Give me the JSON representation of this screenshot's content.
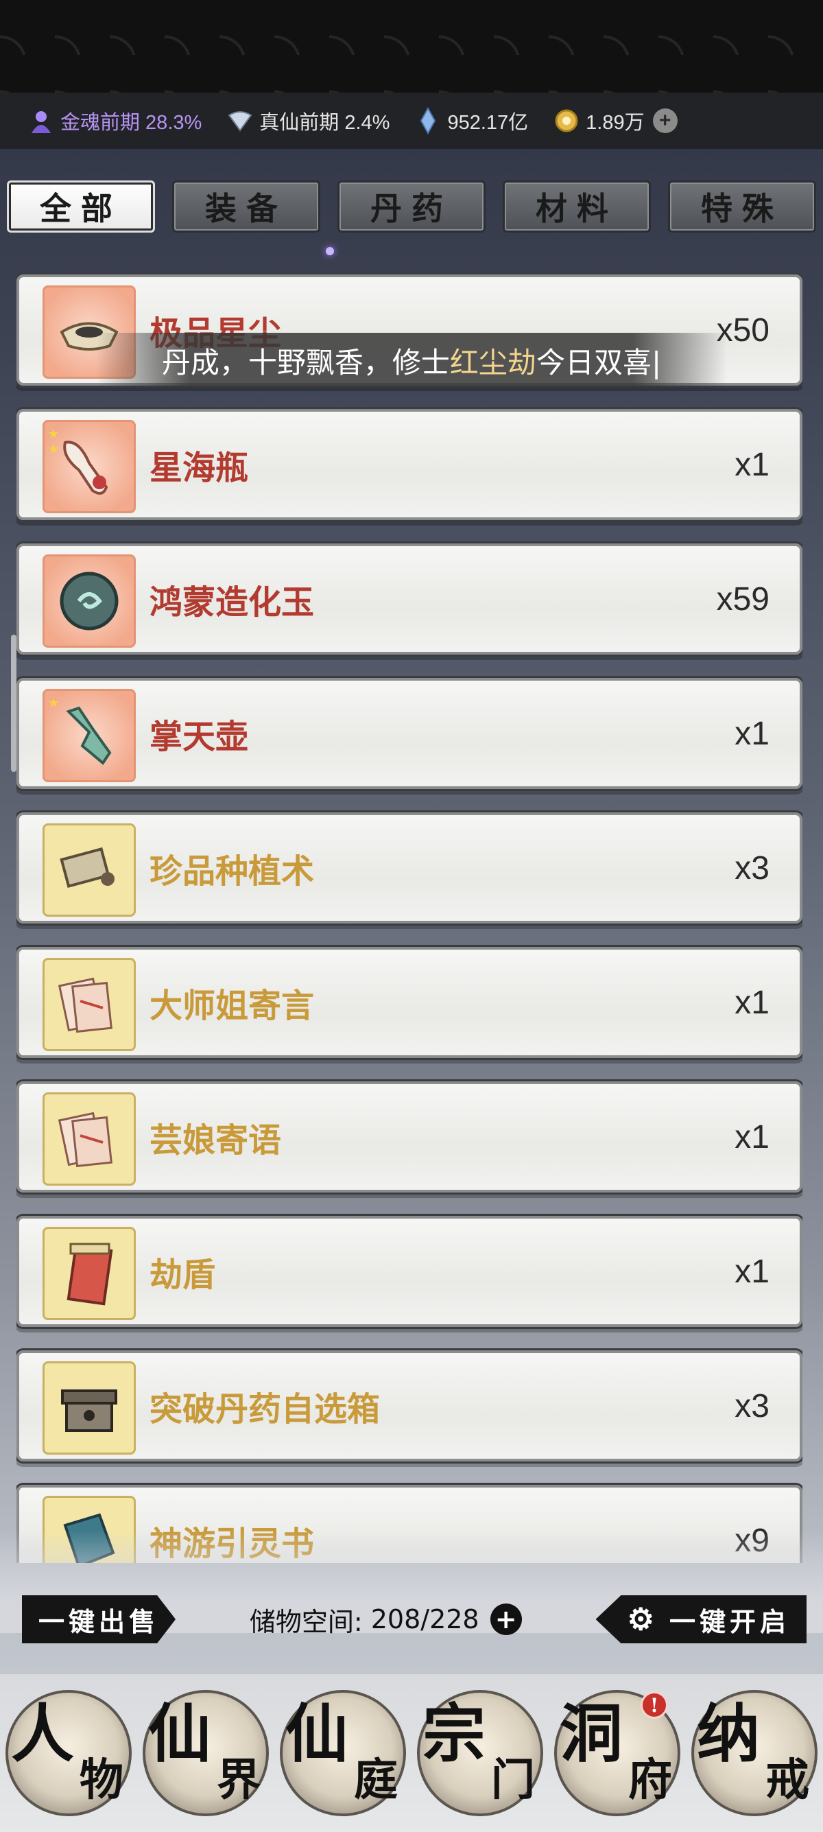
{
  "status": {
    "realm1": "金魂前期 28.3%",
    "realm2": "真仙前期 2.4%",
    "spirit_stones": "952.17亿",
    "currency": "1.89万"
  },
  "tabs": [
    "全部",
    "装备",
    "丹药",
    "材料",
    "特殊"
  ],
  "marquee": {
    "part1": "丹成，十野飘香，修士",
    "highlight": "红尘劫",
    "part2": "今日双喜|"
  },
  "items": [
    {
      "name": "极品星尘",
      "qty": "x50",
      "rarity": "red"
    },
    {
      "name": "星海瓶",
      "qty": "x1",
      "rarity": "red"
    },
    {
      "name": "鸿蒙造化玉",
      "qty": "x59",
      "rarity": "red"
    },
    {
      "name": "掌天壶",
      "qty": "x1",
      "rarity": "red"
    },
    {
      "name": "珍品种植术",
      "qty": "x3",
      "rarity": "yellow"
    },
    {
      "name": "大师姐寄言",
      "qty": "x1",
      "rarity": "yellow"
    },
    {
      "name": "芸娘寄语",
      "qty": "x1",
      "rarity": "yellow"
    },
    {
      "name": "劫盾",
      "qty": "x1",
      "rarity": "yellow"
    },
    {
      "name": "突破丹药自选箱",
      "qty": "x3",
      "rarity": "yellow"
    },
    {
      "name": "神游引灵书",
      "qty": "x9",
      "rarity": "yellow"
    }
  ],
  "actions": {
    "sell_all": "一键出售",
    "storage_label": "储物空间:",
    "storage_value": "208/228",
    "open_all": "一键开启"
  },
  "nav": [
    {
      "c1": "人",
      "c2": "物"
    },
    {
      "c1": "仙",
      "c2": "界"
    },
    {
      "c1": "仙",
      "c2": "庭"
    },
    {
      "c1": "宗",
      "c2": "门"
    },
    {
      "c1": "洞",
      "c2": "府"
    },
    {
      "c1": "纳",
      "c2": "戒"
    }
  ],
  "nav_badge": "!",
  "colors": {
    "rarity_red_text": "#b23a2e",
    "rarity_yellow_text": "#c99a3a",
    "realm_purple": "#b794f4"
  }
}
